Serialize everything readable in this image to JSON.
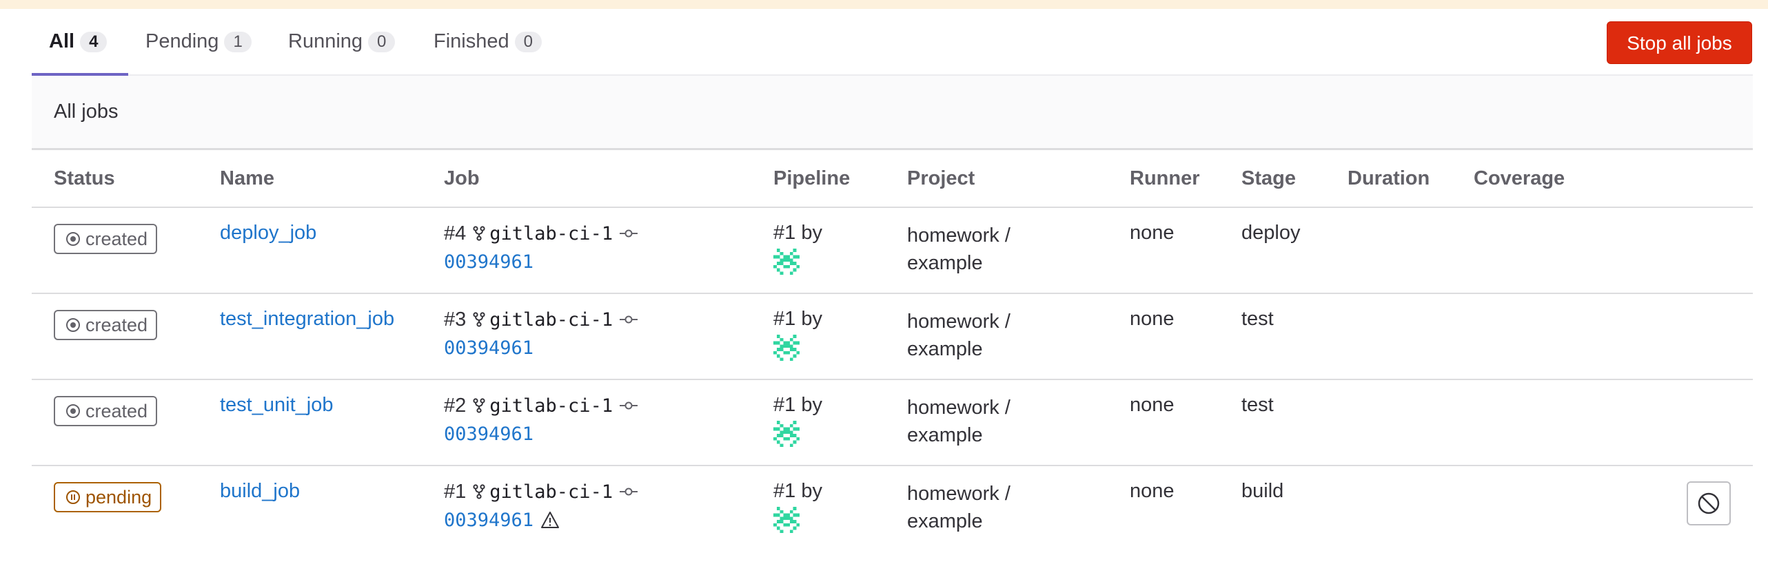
{
  "tabs": [
    {
      "label": "All",
      "count": "4",
      "active": true
    },
    {
      "label": "Pending",
      "count": "1"
    },
    {
      "label": "Running",
      "count": "0"
    },
    {
      "label": "Finished",
      "count": "0"
    }
  ],
  "actions": {
    "stop_all_label": "Stop all jobs"
  },
  "jobs_header": "All jobs",
  "columns": [
    "Status",
    "Name",
    "Job",
    "Pipeline",
    "Project",
    "Runner",
    "Stage",
    "Duration",
    "Coverage"
  ],
  "jobs": [
    {
      "status": "created",
      "name": "deploy_job",
      "job_id": "#4",
      "ref": "gitlab-ci-1",
      "sha": "00394961",
      "pipeline": "#1 by",
      "project": "homework / example",
      "runner": "none",
      "stage": "deploy"
    },
    {
      "status": "created",
      "name": "test_integration_job",
      "job_id": "#3",
      "ref": "gitlab-ci-1",
      "sha": "00394961",
      "pipeline": "#1 by",
      "project": "homework / example",
      "runner": "none",
      "stage": "test"
    },
    {
      "status": "created",
      "name": "test_unit_job",
      "job_id": "#2",
      "ref": "gitlab-ci-1",
      "sha": "00394961",
      "pipeline": "#1 by",
      "project": "homework / example",
      "runner": "none",
      "stage": "test"
    },
    {
      "status": "pending",
      "name": "build_job",
      "job_id": "#1",
      "ref": "gitlab-ci-1",
      "sha": "00394961",
      "pipeline": "#1 by",
      "project": "homework / example",
      "runner": "none",
      "stage": "build",
      "warning": true,
      "cancelable": true
    }
  ],
  "icons": {
    "branch": "branch-icon",
    "commit": "commit-icon",
    "warning": "warning-icon",
    "cancel": "cancel-icon",
    "created": "status-created-icon",
    "pending": "status-pending-icon"
  },
  "colors": {
    "accent_tab": "#6e64c4",
    "danger": "#dd2b0e",
    "link": "#1f75cb",
    "pending": "#ab6100",
    "avatar": "#2fd6a0"
  }
}
